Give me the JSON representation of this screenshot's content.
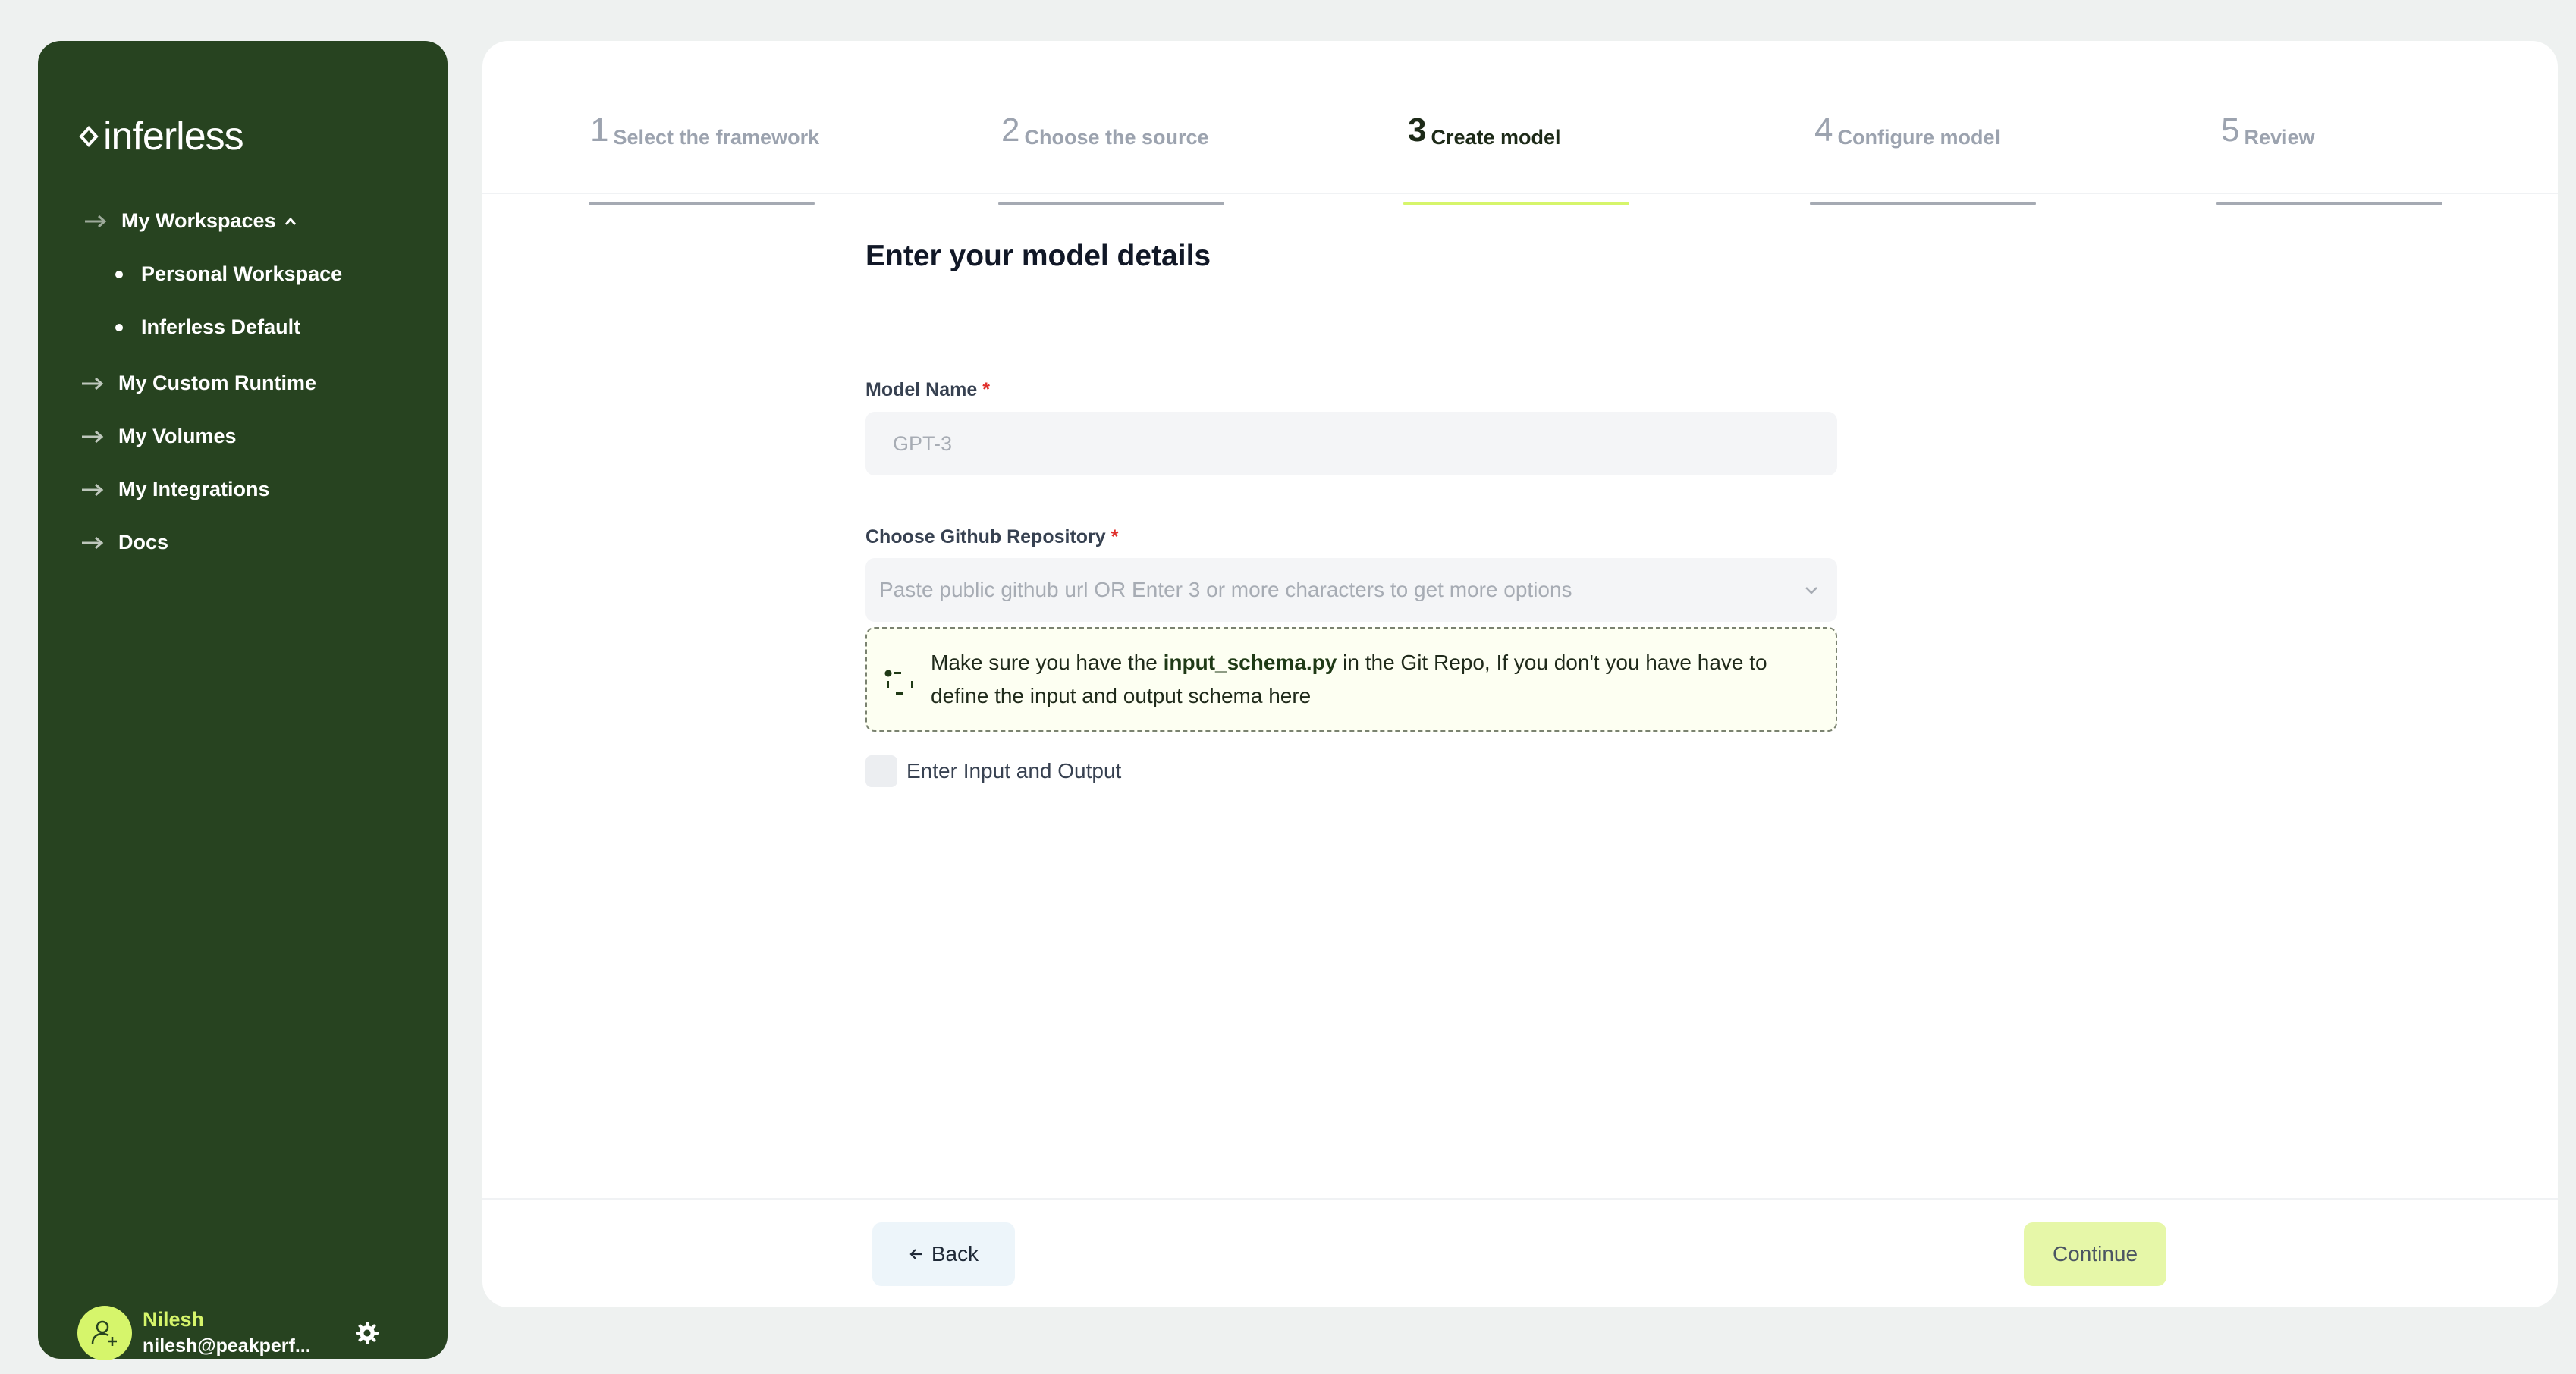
{
  "brand": {
    "name": "inferless"
  },
  "sidebar": {
    "workspaces_label": "My Workspaces",
    "workspaces": [
      {
        "label": "Personal Workspace"
      },
      {
        "label": "Inferless Default"
      }
    ],
    "items": [
      {
        "label": "My Custom Runtime"
      },
      {
        "label": "My Volumes"
      },
      {
        "label": "My Integrations"
      },
      {
        "label": "Docs"
      }
    ],
    "user": {
      "name": "Nilesh",
      "email": "nilesh@peakperf..."
    }
  },
  "stepper": {
    "steps": [
      {
        "num": "1",
        "label": "Select the framework",
        "state": "complete"
      },
      {
        "num": "2",
        "label": "Choose the source",
        "state": "complete"
      },
      {
        "num": "3",
        "label": "Create model",
        "state": "active"
      },
      {
        "num": "4",
        "label": "Configure model",
        "state": "upcoming"
      },
      {
        "num": "5",
        "label": "Review",
        "state": "upcoming"
      }
    ]
  },
  "form": {
    "title": "Enter your model details",
    "model_name": {
      "label": "Model Name",
      "required_mark": "*",
      "placeholder": "GPT-3",
      "value": ""
    },
    "repo": {
      "label": "Choose Github Repository",
      "required_mark": "*",
      "placeholder": "Paste public github url OR Enter 3 or more characters to get more options"
    },
    "notice": {
      "prefix": "Make sure you have the ",
      "file": "input_schema.py",
      "suffix": " in the Git Repo, If you don't you have have to define the input and output schema here"
    },
    "checkbox": {
      "label": "Enter Input and Output",
      "checked": false
    }
  },
  "footer": {
    "back_label": "Back",
    "continue_label": "Continue"
  },
  "colors": {
    "sidebar_bg": "#274320",
    "accent": "#d6f56b",
    "continue_bg": "#e6f7a8",
    "back_bg": "#edf5fa"
  }
}
